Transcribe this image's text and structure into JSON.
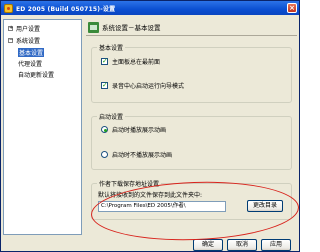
{
  "window": {
    "title": "ED 2005 (Build 050715)-设置",
    "close_symbol": "×"
  },
  "sidebar": {
    "items": [
      {
        "label": "用户设置",
        "expander": "+"
      },
      {
        "label": "系统设置",
        "expander": "−"
      },
      {
        "label": "基本设置"
      },
      {
        "label": "代理设置"
      },
      {
        "label": "自动更新设置"
      }
    ]
  },
  "page": {
    "title": "系统设置－基本设置"
  },
  "basic_group": {
    "title": "基本设置",
    "options": [
      {
        "label": "主面板总在最前面",
        "checked": true
      },
      {
        "label": "录音中心启动运行向导模式",
        "checked": true
      }
    ]
  },
  "startup_group": {
    "title": "启动设置",
    "options": [
      {
        "label": "启动时播放展示动画",
        "selected": true
      },
      {
        "label": "启动时不播放展示动画",
        "selected": false
      }
    ]
  },
  "download_group": {
    "title": "作者下载保存地址设置",
    "description": "默认将接收到的文件保存到此文件夹中:",
    "path_value": "C:\\Program Files\\ED 2005\\作者\\",
    "change_button": "更改目录"
  },
  "footer": {
    "ok": "确定",
    "cancel": "取消",
    "apply": "应用"
  },
  "colors": {
    "title_bar": "#0b4fd1",
    "annotation_ring": "#d8231c",
    "check_mark": "#21a121"
  },
  "check_symbol": "✓"
}
